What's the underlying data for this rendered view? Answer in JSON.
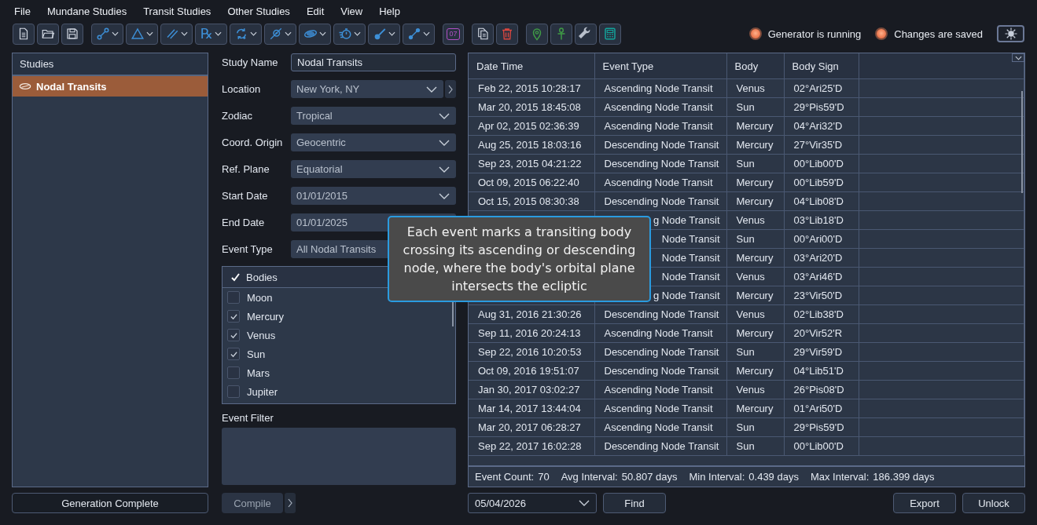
{
  "menu": [
    "File",
    "Mundane Studies",
    "Transit Studies",
    "Other Studies",
    "Edit",
    "View",
    "Help"
  ],
  "toolbar": [
    [
      {
        "kind": "plain"
      },
      {
        "kind": "plain"
      },
      {
        "kind": "plain"
      }
    ],
    [
      {
        "kind": "dropdown"
      },
      {
        "kind": "dropdown"
      },
      {
        "kind": "dropdown"
      },
      {
        "kind": "dropdown",
        "text": "℞"
      },
      {
        "kind": "dropdown"
      },
      {
        "kind": "dropdown"
      },
      {
        "kind": "dropdown"
      },
      {
        "kind": "dropdown"
      },
      {
        "kind": "dropdown"
      },
      {
        "kind": "dropdown"
      }
    ],
    [
      {
        "kind": "plain",
        "text": "07"
      }
    ],
    [
      {
        "kind": "plain"
      },
      {
        "kind": "plain"
      }
    ],
    [
      {
        "kind": "plain"
      },
      {
        "kind": "plain"
      },
      {
        "kind": "plain"
      },
      {
        "kind": "plain"
      }
    ]
  ],
  "status": [
    {
      "label": "Generator is running",
      "on": true
    },
    {
      "label": "Changes are saved",
      "on": true
    }
  ],
  "studies": {
    "title": "Studies",
    "items": [
      {
        "label": "Nodal Transits",
        "selected": true
      }
    ]
  },
  "form": [
    {
      "label": "Study Name",
      "value": "Nodal Transits",
      "kind": "text"
    },
    {
      "label": "Location",
      "value": "New York, NY",
      "kind": "select",
      "side_button": true
    },
    {
      "label": "Zodiac",
      "value": "Tropical",
      "kind": "select"
    },
    {
      "label": "Coord. Origin",
      "value": "Geocentric",
      "kind": "select"
    },
    {
      "label": "Ref. Plane",
      "value": "Equatorial",
      "kind": "select"
    },
    {
      "label": "Start Date",
      "value": "01/01/2015",
      "kind": "select"
    },
    {
      "label": "End Date",
      "value": "01/01/2025",
      "kind": "box"
    },
    {
      "label": "Event Type",
      "value": "All Nodal Transits",
      "kind": "box"
    }
  ],
  "bodies": {
    "title": "Bodies",
    "checked": true,
    "items": [
      {
        "label": "Moon",
        "checked": false
      },
      {
        "label": "Mercury",
        "checked": true
      },
      {
        "label": "Venus",
        "checked": true
      },
      {
        "label": "Sun",
        "checked": true
      },
      {
        "label": "Mars",
        "checked": false
      },
      {
        "label": "Jupiter",
        "checked": false
      }
    ]
  },
  "event_filter": {
    "label": "Event Filter"
  },
  "left_button": "Generation Complete",
  "compile_button": {
    "label": "Compile",
    "disabled": true
  },
  "table": {
    "columns": [
      "Date Time",
      "Event Type",
      "Body",
      "Body Sign"
    ],
    "rows": [
      {
        "date_time": "Feb 22, 2015 10:28:17",
        "event_type": "Ascending Node Transit",
        "body": "Venus",
        "body_sign": "02°Ari25'D"
      },
      {
        "date_time": "Mar 20, 2015 18:45:08",
        "event_type": "Ascending Node Transit",
        "body": "Sun",
        "body_sign": "29°Pis59'D"
      },
      {
        "date_time": "Apr 02, 2015 02:36:39",
        "event_type": "Ascending Node Transit",
        "body": "Mercury",
        "body_sign": "04°Ari32'D"
      },
      {
        "date_time": "Aug 25, 2015 18:03:16",
        "event_type": "Descending Node Transit",
        "body": "Mercury",
        "body_sign": "27°Vir35'D"
      },
      {
        "date_time": "Sep 23, 2015 04:21:22",
        "event_type": "Descending Node Transit",
        "body": "Sun",
        "body_sign": "00°Lib00'D"
      },
      {
        "date_time": "Oct 09, 2015 06:22:40",
        "event_type": "Ascending Node Transit",
        "body": "Mercury",
        "body_sign": "00°Lib59'D"
      },
      {
        "date_time": "Oct 15, 2015 08:30:38",
        "event_type": "Descending Node Transit",
        "body": "Mercury",
        "body_sign": "04°Lib08'D"
      },
      {
        "event_type": "g Node Transit",
        "body": "Venus",
        "body_sign": "03°Lib18'D"
      },
      {
        "event_type": "Node Transit",
        "body": "Sun",
        "body_sign": "00°Ari00'D"
      },
      {
        "event_type": "Node Transit",
        "body": "Mercury",
        "body_sign": "03°Ari20'D"
      },
      {
        "event_type": "Node Transit",
        "body": "Venus",
        "body_sign": "03°Ari46'D"
      },
      {
        "event_type": "g Node Transit",
        "body": "Mercury",
        "body_sign": "23°Vir50'D"
      },
      {
        "date_time": "Aug 31, 2016 21:30:26",
        "event_type": "Descending Node Transit",
        "body": "Venus",
        "body_sign": "02°Lib38'D"
      },
      {
        "date_time": "Sep 11, 2016 20:24:13",
        "event_type": "Ascending Node Transit",
        "body": "Mercury",
        "body_sign": "20°Vir52'R"
      },
      {
        "date_time": "Sep 22, 2016 10:20:53",
        "event_type": "Descending Node Transit",
        "body": "Sun",
        "body_sign": "29°Vir59'D"
      },
      {
        "date_time": "Oct 09, 2016 19:51:07",
        "event_type": "Descending Node Transit",
        "body": "Mercury",
        "body_sign": "04°Lib51'D"
      },
      {
        "date_time": "Jan 30, 2017 03:02:27",
        "event_type": "Ascending Node Transit",
        "body": "Venus",
        "body_sign": "26°Pis08'D"
      },
      {
        "date_time": "Mar 14, 2017 13:44:04",
        "event_type": "Ascending Node Transit",
        "body": "Mercury",
        "body_sign": "01°Ari50'D"
      },
      {
        "date_time": "Mar 20, 2017 06:28:27",
        "event_type": "Ascending Node Transit",
        "body": "Sun",
        "body_sign": "29°Pis59'D"
      },
      {
        "date_time": "Sep 22, 2017 16:02:28",
        "event_type": "Descending Node Transit",
        "body": "Sun",
        "body_sign": "00°Lib00'D"
      }
    ],
    "stats": [
      {
        "label": "Event Count:",
        "value": "70"
      },
      {
        "label": "Avg Interval:",
        "value": "50.807 days"
      },
      {
        "label": "Min Interval:",
        "value": "0.439 days"
      },
      {
        "label": "Max Interval:",
        "value": "186.399 days"
      }
    ]
  },
  "date_picker": {
    "value": "05/04/2026"
  },
  "buttons": [
    "Find",
    "Export",
    "Unlock"
  ],
  "tooltip": "Each event marks a transiting body crossing its ascending or descending node, where the body's orbital plane intersects the ecliptic"
}
